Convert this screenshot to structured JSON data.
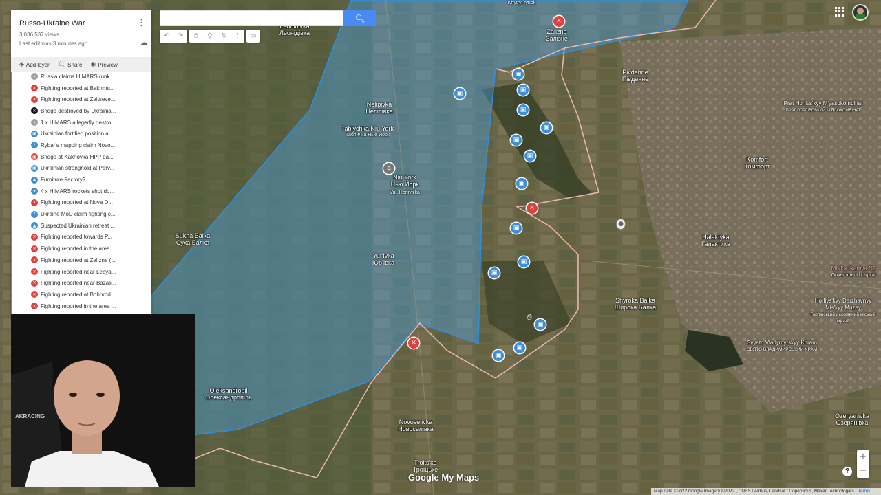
{
  "map": {
    "title": "Russo-Ukraine War",
    "views": "3,036,537 views",
    "last_edit": "Last edit was 3 minutes ago",
    "colors": {
      "ukraine_zone": "#4aa3e8",
      "russia_border": "#f1b8b8",
      "terrain": "#6b6546"
    }
  },
  "search": {
    "placeholder": "",
    "button_icon": "search-icon"
  },
  "toolbar": {
    "icons": [
      "undo-icon",
      "redo-icon",
      "hand-icon",
      "marker-icon",
      "draw-line-icon",
      "directions-icon",
      "ruler-icon"
    ]
  },
  "actions": {
    "add_layer": "Add layer",
    "share": "Share",
    "preview": "Preview"
  },
  "layer_items": [
    {
      "label": "Russia claims HIMARS (unk...",
      "icon": "grey",
      "glyph": "✦"
    },
    {
      "label": "Fighting reported at Bakhmu...",
      "icon": "red",
      "glyph": "✕"
    },
    {
      "label": "Fighting reported at Zaitseve...",
      "icon": "red",
      "glyph": "✕"
    },
    {
      "label": "Bridge destroyed by Ukrainia...",
      "icon": "black",
      "glyph": "✕"
    },
    {
      "label": "1 x HIMARS allegedly destro...",
      "icon": "grey",
      "glyph": "✦"
    },
    {
      "label": "Ukrainian fortified position a...",
      "icon": "blue",
      "glyph": "▣"
    },
    {
      "label": "Rybar's mapping claim Novo...",
      "icon": "blue",
      "glyph": "?"
    },
    {
      "label": "Bridge at Kakhovka HPP da...",
      "icon": "red",
      "glyph": "▣"
    },
    {
      "label": "Ukrainian stronghold at Perv...",
      "icon": "blue",
      "glyph": "▣"
    },
    {
      "label": "Furniture Factory?",
      "icon": "blue",
      "glyph": "▲"
    },
    {
      "label": "4 x HIMARS rockets shot do...",
      "icon": "blue",
      "glyph": "✦"
    },
    {
      "label": "Fighting reported at Nova D...",
      "icon": "red",
      "glyph": "✕"
    },
    {
      "label": "Ukraine MoD claim fighting c...",
      "icon": "blue",
      "glyph": "?"
    },
    {
      "label": "Suspected Ukrainian retreat ...",
      "icon": "blue",
      "glyph": "▲"
    },
    {
      "label": "Fighting reported towards P...",
      "icon": "red",
      "glyph": "✕"
    },
    {
      "label": "Fighting reported in the area ...",
      "icon": "red",
      "glyph": "✕"
    },
    {
      "label": "Fighting reported at Zalizne (...",
      "icon": "red",
      "glyph": "✕"
    },
    {
      "label": "Fighting reported near Lebya...",
      "icon": "red",
      "glyph": "✕"
    },
    {
      "label": "Fighting reported near Bazali...",
      "icon": "red",
      "glyph": "✕"
    },
    {
      "label": "Fighting reported at Bohorod...",
      "icon": "red",
      "glyph": "✕"
    },
    {
      "label": "Fighting reported in the area ...",
      "icon": "red",
      "glyph": "✕"
    }
  ],
  "places": [
    {
      "name": "Leonidivka",
      "local": "Леонідівка"
    },
    {
      "name": "Zalizne",
      "local": "Залізне"
    },
    {
      "name": "Pivdenne",
      "local": "Південне"
    },
    {
      "name": "Nelipivka",
      "local": "Неліпівка"
    },
    {
      "name": "Tablychka Niu York",
      "local": "Табличка Нью Йорк"
    },
    {
      "name": "Niu York",
      "local": "Нью Йорк"
    },
    {
      "name": "Sukha Balka",
      "local": "Суха Балка"
    },
    {
      "name": "Yur'ivka",
      "local": "Юр'ївка"
    },
    {
      "name": "Oleksandropil",
      "local": "Олександропіль"
    },
    {
      "name": "Novoselivka",
      "local": "Новоселівка"
    },
    {
      "name": "Troits'ke",
      "local": "Троїцьке"
    },
    {
      "name": "Shyroka Balka",
      "local": "Широка Балка"
    },
    {
      "name": "Halaktyka",
      "local": "Галактика"
    },
    {
      "name": "Komfort",
      "local": "Комфорт"
    },
    {
      "name": "Prat Horlivs'kyy M'yasokombinat",
      "local": "ПРАТ ГОРЛІВСЬКИЙ М'ЯСОКОМБІНАТ"
    },
    {
      "name": "Svyato Vladymyrskyy Khram",
      "local": "СВЯТО ВЛАДИМИРСЬКИЙ ХРАМ"
    },
    {
      "name": "Horlivs'kyy Derzhavnyy Mis'kyy Muzey",
      "local": "Горлівський державний міський музей"
    },
    {
      "name": "Ozeryanivka",
      "local": "Озерянівка"
    },
    {
      "name": "Mis'ka likarnya N2",
      "local": "Government hospital"
    },
    {
      "name": "Khytryi rynok",
      "local": ""
    },
    {
      "name": "Vul. Horlivs'ka",
      "local": ""
    }
  ],
  "footer": {
    "attribution": "Map data ©2022 Google Imagery ©2022 , CNES / Airbus, Landsat / Copernicus, Maxar Technologies",
    "terms": "Terms",
    "logo": "Google My Maps",
    "zoom_in": "+",
    "zoom_out": "−",
    "help": "?"
  },
  "webcam": {
    "shirt_text": "AKRACING"
  }
}
